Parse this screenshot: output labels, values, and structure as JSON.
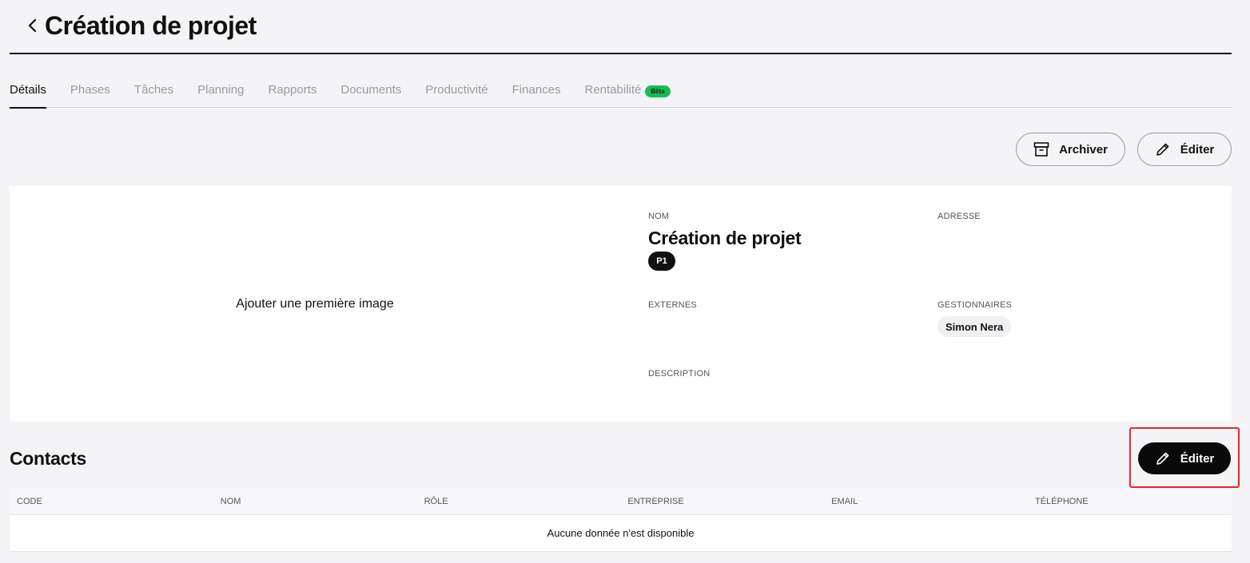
{
  "header": {
    "title": "Création de projet"
  },
  "tabs": [
    {
      "label": "Détails"
    },
    {
      "label": "Phases"
    },
    {
      "label": "Tâches"
    },
    {
      "label": "Planning"
    },
    {
      "label": "Rapports"
    },
    {
      "label": "Documents"
    },
    {
      "label": "Productivité"
    },
    {
      "label": "Finances"
    },
    {
      "label": "Rentabilité",
      "badge": "Bêta"
    }
  ],
  "actions": {
    "archive_label": "Archiver",
    "edit_label": "Éditer"
  },
  "details": {
    "add_image_label": "Ajouter une première image",
    "name_label": "NOM",
    "name_value": "Création de projet",
    "code": "P1",
    "address_label": "ADRESSE",
    "externals_label": "EXTERNES",
    "managers_label": "GESTIONNAIRES",
    "manager": "Simon Nera",
    "description_label": "DESCRIPTION"
  },
  "contacts": {
    "title": "Contacts",
    "edit_label": "Éditer",
    "columns": [
      "CODE",
      "NOM",
      "RÔLE",
      "ENTREPRISE",
      "EMAIL",
      "TÉLÉPHONE"
    ],
    "empty_text": "Aucune donnée n'est disponible"
  },
  "colors": {
    "accent_green": "#1db954",
    "highlight_red": "#e8262d",
    "dark": "#0a0a0a"
  }
}
